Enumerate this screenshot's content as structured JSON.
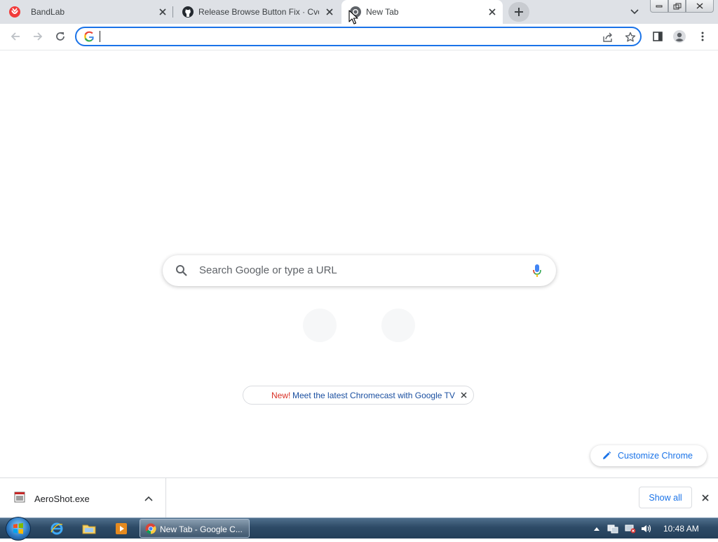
{
  "tabs": [
    {
      "title": "BandLab",
      "favicon": "bandlab-icon",
      "active": false
    },
    {
      "title": "Release Browse Button Fix · Cvolt",
      "favicon": "github-icon",
      "active": false
    },
    {
      "title": "New Tab",
      "favicon": "chrome-icon",
      "active": true
    }
  ],
  "toolbar": {
    "address_value": "",
    "icons": [
      "back-icon",
      "forward-icon",
      "reload-icon",
      "share-icon",
      "bookmark-star-icon",
      "side-panel-icon",
      "profile-icon",
      "menu-icon"
    ]
  },
  "ntp": {
    "search_placeholder": "Search Google or type a URL",
    "promo_new": "New!",
    "promo_text": "Meet the latest Chromecast with Google TV",
    "customize_label": "Customize Chrome"
  },
  "downloads": {
    "file_name": "AeroShot.exe",
    "show_all_label": "Show all"
  },
  "taskbar": {
    "chrome_label": "New Tab - Google C...",
    "clock": "10:48 AM"
  },
  "colors": {
    "accent": "#1a73e8",
    "tabstrip": "#dee1e6",
    "promo_new": "#d93025"
  }
}
